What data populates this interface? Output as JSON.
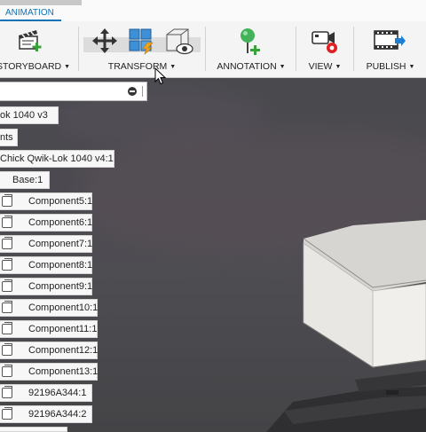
{
  "ribbon": {
    "active_tab": "ANIMATION",
    "groups": [
      {
        "label": "STORYBOARD",
        "icon": "storyboard-icon"
      },
      {
        "label": "TRANSFORM",
        "icon": "move-icon"
      },
      {
        "label": "ANNOTATION",
        "icon": "annotation-pin-icon"
      },
      {
        "label": "VIEW",
        "icon": "camera-record-icon"
      },
      {
        "label": "PUBLISH",
        "icon": "publish-film-icon"
      }
    ],
    "caret": "▼"
  },
  "browser": {
    "search_value": "",
    "nodes": [
      {
        "label": "ok 1040 v3"
      },
      {
        "label": "nts"
      },
      {
        "label": "Chick Qwik-Lok 1040 v4:1"
      },
      {
        "label": "Base:1"
      }
    ],
    "components": [
      "Component5:1",
      "Component6:1",
      "Component7:1",
      "Component8:1",
      "Component9:1",
      "Component10:1",
      "Component11:1",
      "Component12:1",
      "Component13:1",
      "92196A344:1",
      "92196A344:2"
    ]
  },
  "colors": {
    "accent": "#0e72b5",
    "toolbar_bg": "#f4f4f4",
    "viewport_bg": "#4a4a4e",
    "model_face": "#e7e5e2"
  }
}
